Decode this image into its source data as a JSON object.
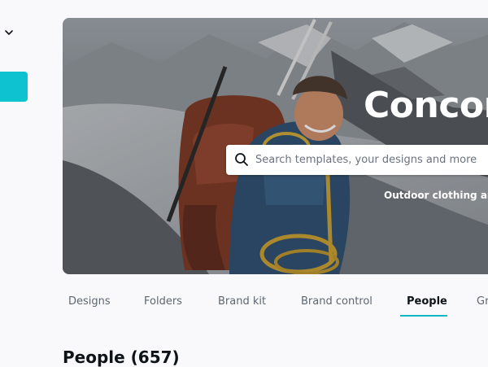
{
  "sidebar": {
    "collapse_icon": "chevron-down-icon",
    "accent_color": "#0fc2cf"
  },
  "hero": {
    "title": "Concord",
    "subtitle": "Outdoor clothing and",
    "search": {
      "placeholder": "Search templates, your designs and more",
      "value": "",
      "icon": "search-icon"
    },
    "image": "mountaineer-with-backpack-on-glacier"
  },
  "tabs": [
    {
      "label": "Designs",
      "active": false
    },
    {
      "label": "Folders",
      "active": false
    },
    {
      "label": "Brand kit",
      "active": false
    },
    {
      "label": "Brand control",
      "active": false
    },
    {
      "label": "People",
      "active": true
    },
    {
      "label": "Gr",
      "active": false
    }
  ],
  "section": {
    "title": "People (657)"
  },
  "colors": {
    "active_tab_underline": "#0fb8c9",
    "background": "#f9f9fb"
  }
}
